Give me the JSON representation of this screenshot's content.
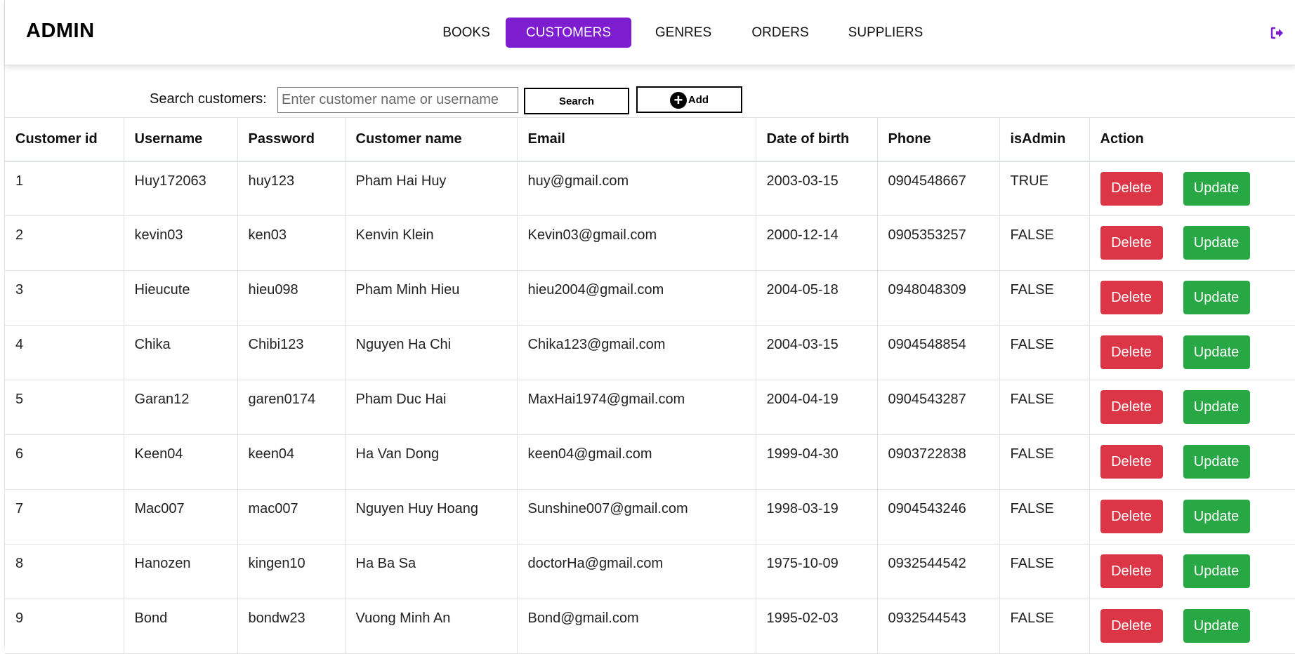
{
  "header": {
    "brand": "ADMIN",
    "nav": [
      {
        "label": "BOOKS",
        "active": false
      },
      {
        "label": "CUSTOMERS",
        "active": true
      },
      {
        "label": "GENRES",
        "active": false
      },
      {
        "label": "ORDERS",
        "active": false
      },
      {
        "label": "SUPPLIERS",
        "active": false
      }
    ],
    "logout_icon": "sign-out-icon"
  },
  "search": {
    "label": "Search customers:",
    "placeholder": "Enter customer name or username",
    "value": "",
    "search_button": "Search",
    "add_button": "Add",
    "add_icon": "plus-circle-icon"
  },
  "table": {
    "columns": [
      "Customer id",
      "Username",
      "Password",
      "Customer name",
      "Email",
      "Date of birth",
      "Phone",
      "isAdmin",
      "Action"
    ],
    "rows": [
      [
        "1",
        "Huy172063",
        "huy123",
        "Pham Hai Huy",
        "huy@gmail.com",
        "2003-03-15",
        "0904548667",
        "TRUE"
      ],
      [
        "2",
        "kevin03",
        "ken03",
        "Kenvin Klein",
        "Kevin03@gmail.com",
        "2000-12-14",
        "0905353257",
        "FALSE"
      ],
      [
        "3",
        "Hieucute",
        "hieu098",
        "Pham Minh Hieu",
        "hieu2004@gmail.com",
        "2004-05-18",
        "0948048309",
        "FALSE"
      ],
      [
        "4",
        "Chika",
        "Chibi123",
        "Nguyen Ha Chi",
        "Chika123@gmail.com",
        "2004-03-15",
        "0904548854",
        "FALSE"
      ],
      [
        "5",
        "Garan12",
        "garen0174",
        "Pham Duc Hai",
        "MaxHai1974@gmail.com",
        "2004-04-19",
        "0904543287",
        "FALSE"
      ],
      [
        "6",
        "Keen04",
        "keen04",
        "Ha Van Dong",
        "keen04@gmail.com",
        "1999-04-30",
        "0903722838",
        "FALSE"
      ],
      [
        "7",
        "Mac007",
        "mac007",
        "Nguyen Huy Hoang",
        "Sunshine007@gmail.com",
        "1998-03-19",
        "0904543246",
        "FALSE"
      ],
      [
        "8",
        "Hanozen",
        "kingen10",
        "Ha Ba Sa",
        "doctorHa@gmail.com",
        "1975-10-09",
        "0932544542",
        "FALSE"
      ],
      [
        "9",
        "Bond",
        "bondw23",
        "Vuong Minh An",
        "Bond@gmail.com",
        "1995-02-03",
        "0932544543",
        "FALSE"
      ]
    ],
    "delete_label": "Delete",
    "update_label": "Update"
  },
  "colors": {
    "accent": "#7e1ccf",
    "delete": "#dc3545",
    "update": "#28a745"
  }
}
